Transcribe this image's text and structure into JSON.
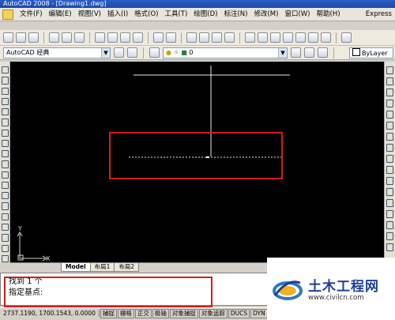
{
  "window": {
    "title": "AutoCAD 2008 - [Drawing1.dwg]"
  },
  "menu": {
    "items": [
      "文件(F)",
      "编辑(E)",
      "视图(V)",
      "插入(I)",
      "格式(O)",
      "工具(T)",
      "绘图(D)",
      "标注(N)",
      "修改(M)",
      "窗口(W)",
      "帮助(H)",
      "Express"
    ]
  },
  "toolbar2": {
    "workspace": "AutoCAD 经典",
    "layer": "0",
    "linetype": "ByLayer"
  },
  "canvas": {
    "ucs_x": "X",
    "ucs_y": "Y"
  },
  "tabs": [
    "Model",
    "布局1",
    "布局2"
  ],
  "command": {
    "line1": "找到 1 个",
    "line2": "指定基点:"
  },
  "status": {
    "coords": "2737.1190, 1700.1543, 0.0000",
    "buttons": [
      "捕捉",
      "栅格",
      "正交",
      "极轴",
      "对象捕捉",
      "对象追踪",
      "DUCS",
      "DYN"
    ]
  },
  "watermark": {
    "name": "土木工程网",
    "url": "www.civilcn.com"
  },
  "colors": {
    "highlight": "#d51c1c",
    "canvas": "#000000",
    "brand": "#1f3f9a"
  }
}
